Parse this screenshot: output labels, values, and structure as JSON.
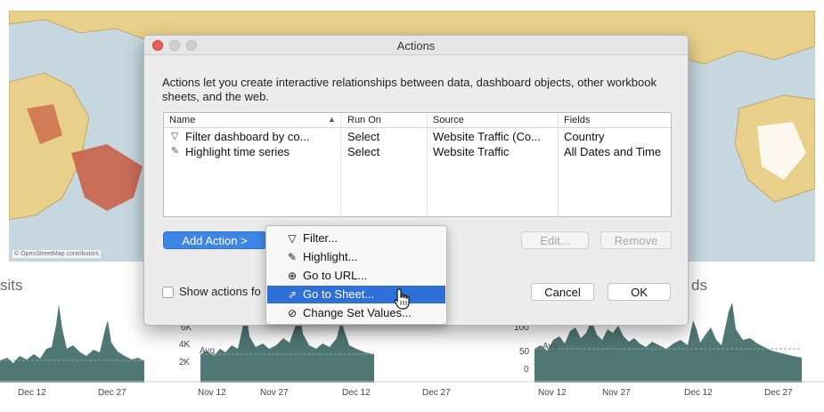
{
  "background": {
    "map_attribution": "© OpenStreetMap contributors",
    "left_title_fragment": "sits",
    "right_title_fragment": "ds",
    "ticks": {
      "left_x": [
        "Dec 12",
        "Dec 27"
      ],
      "mid_x": [
        "Nov 12",
        "Nov 27",
        "Dec 12",
        "Dec 27"
      ],
      "right_x": [
        "Nov 12",
        "Nov 27",
        "Dec 12",
        "Dec 27"
      ],
      "mid_y": [
        "6K",
        "4K",
        "2K"
      ],
      "right_y": [
        "100",
        "50",
        "0"
      ]
    },
    "avg_label": "Avg",
    "colors": {
      "fill": "#4f7774",
      "map_land": "#e9d08a",
      "map_water": "#c6d7e0",
      "map_red": "#c85a3f"
    }
  },
  "dialog": {
    "title": "Actions",
    "description": "Actions let you create interactive relationships between data, dashboard objects, other workbook sheets, and the web.",
    "table": {
      "columns": [
        "Name",
        "Run On",
        "Source",
        "Fields"
      ],
      "rows": [
        {
          "icon": "filter-icon",
          "name": "Filter dashboard by co...",
          "run_on": "Select",
          "source": "Website Traffic (Co...",
          "fields": "Country"
        },
        {
          "icon": "highlight-icon",
          "name": "Highlight time series",
          "run_on": "Select",
          "source": "Website Traffic",
          "fields": "All Dates and Time"
        }
      ]
    },
    "buttons": {
      "add_action": "Add Action >",
      "edit": "Edit...",
      "remove": "Remove",
      "cancel": "Cancel",
      "ok": "OK"
    },
    "show_actions_label": "Show actions fo",
    "show_actions_checked": false
  },
  "menu": {
    "items": [
      {
        "icon": "filter-icon",
        "label": "Filter..."
      },
      {
        "icon": "highlight-icon",
        "label": "Highlight..."
      },
      {
        "icon": "globe-icon",
        "label": "Go to URL..."
      },
      {
        "icon": "sheet-icon",
        "label": "Go to Sheet..."
      },
      {
        "icon": "set-values-icon",
        "label": "Change Set Values..."
      }
    ],
    "active_index": 3
  }
}
